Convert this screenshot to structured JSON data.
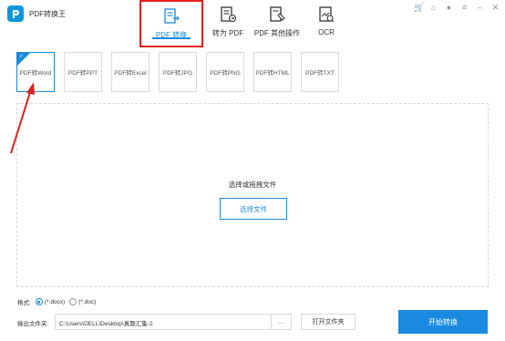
{
  "app": {
    "title": "PDF转换王"
  },
  "nav": {
    "tabs": [
      {
        "label": "PDF 转换",
        "icon": "pdf-convert-icon",
        "active": true
      },
      {
        "label": "转为 PDF",
        "icon": "to-pdf-icon"
      },
      {
        "label": "PDF 其他操作",
        "icon": "pdf-other-ops-icon"
      },
      {
        "label": "OCR",
        "icon": "ocr-icon"
      }
    ]
  },
  "window_controls": [
    "cart-icon",
    "shop-icon",
    "user-icon",
    "menu-icon",
    "minimize-icon",
    "close-icon"
  ],
  "formats": [
    {
      "label": "PDF转Word",
      "active": true
    },
    {
      "label": "PDF转PPT"
    },
    {
      "label": "PDF转Excel"
    },
    {
      "label": "PDF转JPG"
    },
    {
      "label": "PDF转PNG"
    },
    {
      "label": "PDF转HTML"
    },
    {
      "label": "PDF转TXT"
    }
  ],
  "dropzone": {
    "hint": "选择或拖拽文件",
    "button": "选择文件"
  },
  "footer": {
    "format_label": "格式:",
    "option_docx": "(*.docx)",
    "option_doc": "(*.doc)",
    "output_label": "输出文件夹:",
    "output_path": "C:\\Users\\DELL\\Desktop\\真题汇集-2",
    "more_button": "...",
    "open_folder": "打开文件夹",
    "start_button": "开始转换"
  },
  "colors": {
    "accent": "#1a8ae0",
    "highlight": "#e02020"
  }
}
